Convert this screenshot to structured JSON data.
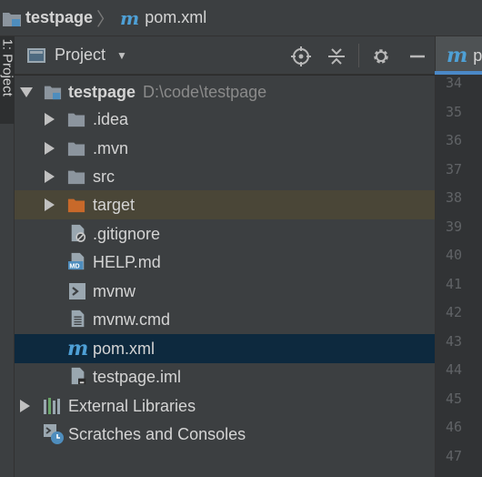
{
  "breadcrumb": {
    "project": "testpage",
    "file": "pom.xml"
  },
  "sidebar": {
    "tab_label": "1: Project"
  },
  "tool_window": {
    "title": "Project",
    "icons": [
      "locate-icon",
      "collapse-all-icon",
      "gear-icon",
      "hide-icon"
    ]
  },
  "editor": {
    "tab_label_partial": "p",
    "line_numbers": [
      "34",
      "35",
      "36",
      "37",
      "38",
      "39",
      "40",
      "41",
      "42",
      "43",
      "44",
      "45",
      "46",
      "47"
    ]
  },
  "tree": {
    "root": {
      "name": "testpage",
      "path": "D:\\code\\testpage"
    },
    "children": [
      {
        "name": ".idea",
        "icon": "folder-icon"
      },
      {
        "name": ".mvn",
        "icon": "folder-icon"
      },
      {
        "name": "src",
        "icon": "folder-icon"
      },
      {
        "name": "target",
        "icon": "folder-orange-icon"
      },
      {
        "name": ".gitignore",
        "icon": "gitignore-file-icon"
      },
      {
        "name": "HELP.md",
        "icon": "markdown-file-icon"
      },
      {
        "name": "mvnw",
        "icon": "shell-file-icon"
      },
      {
        "name": "mvnw.cmd",
        "icon": "text-file-icon"
      },
      {
        "name": "pom.xml",
        "icon": "maven-icon"
      },
      {
        "name": "testpage.iml",
        "icon": "iml-file-icon"
      }
    ],
    "external_libraries": "External Libraries",
    "scratches": "Scratches and Consoles"
  },
  "colors": {
    "selection": "#0d293e",
    "excluded_folder_highlight": "#4a4637",
    "maven_blue": "#4ea0d6",
    "folder_gray": "#8c959e",
    "folder_orange": "#c8692a"
  }
}
